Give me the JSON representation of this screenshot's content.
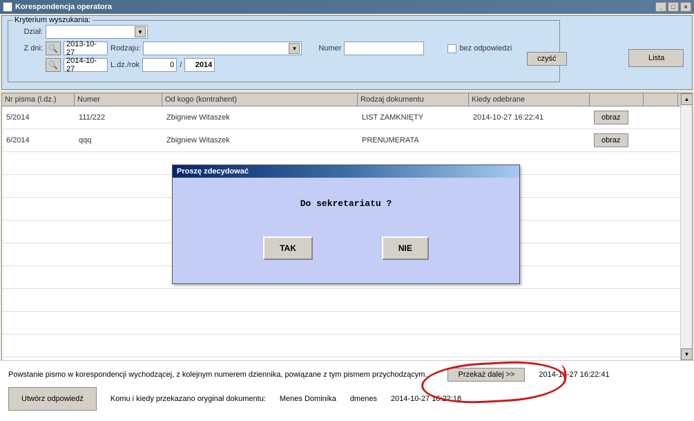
{
  "window": {
    "title": "Korespondencja operatora"
  },
  "search": {
    "legend": "Kryterium wyszukania:",
    "dzial_label": "Dział:",
    "dzial_value": "",
    "zdni_label": "Z dni:",
    "date_from": "2013-10-27",
    "date_to": "2014-10-27",
    "rodzaju_label": "Rodzaju:",
    "rodzaju_value": "",
    "numer_label": "Numer",
    "numer_value": "",
    "ldz_label": "L.dz./rok",
    "ldz_num": "0",
    "ldz_sep": "/",
    "ldz_year": "2014",
    "bez_odp": "bez odpowiedzi",
    "czysc": "czyść",
    "lista": "Lista"
  },
  "table": {
    "headers": [
      "Nr pisma (l.dz.)",
      "Numer",
      "Od kogo (kontrahent)",
      "Rodzaj dokumentu",
      "Kiedy odebrane",
      "",
      ""
    ],
    "rows": [
      {
        "nr": "5/2014",
        "numer": "111/222",
        "od": "Zbigniew Witaszek",
        "rodzaj": "LIST ZAMKNIĘTY",
        "kiedy": "2014-10-27 16:22:41",
        "btn": "obraz"
      },
      {
        "nr": "6/2014",
        "numer": "qqq",
        "od": "Zbigniew Witaszek",
        "rodzaj": "PRENUMERATA",
        "kiedy": "",
        "btn": "obraz"
      }
    ]
  },
  "dialog": {
    "title": "Proszę zdecydować",
    "message": "Do sekretariatu ?",
    "yes": "TAK",
    "no": "NIE"
  },
  "bottom": {
    "note": "Powstanie pismo w korespondencji wychodzącej, z kolejnym numerem dziennika, powiązane z tym pismem przychodzącym.",
    "utworz": "Utwórz odpowiedź",
    "przekaz": "Przekaż dalej >>",
    "przekaz_date": "2014-10-27 16:22:41",
    "komu_label": "Komu i kiedy przekazano oryginał dokumentu:",
    "komu_name": "Menes Dominika",
    "komu_login": "dmenes",
    "komu_date": "2014-10-27 16:22:18"
  }
}
